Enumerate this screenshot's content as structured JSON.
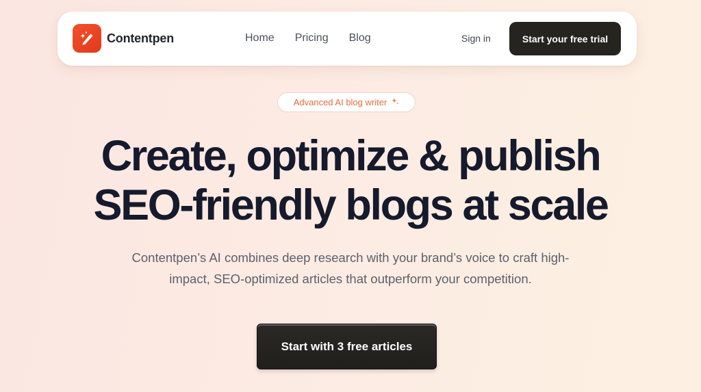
{
  "brand": {
    "name": "Contentpen",
    "accent_color": "#e8452a",
    "logo_icon": "pen-sparkle-icon"
  },
  "nav": {
    "links": [
      {
        "label": "Home"
      },
      {
        "label": "Pricing"
      },
      {
        "label": "Blog"
      }
    ],
    "signin_label": "Sign in",
    "trial_label": "Start your free trial"
  },
  "hero": {
    "badge_label": "Advanced AI blog writer",
    "badge_icon": "sparkle-icon",
    "headline_line1": "Create, optimize & publish",
    "headline_line2": "SEO-friendly blogs at scale",
    "subtext_line1": "Contentpen’s AI combines deep research with your brand’s voice to craft high-",
    "subtext_line2": "impact, SEO-optimized articles that outperform your competition.",
    "cta_label": "Start with 3 free articles"
  },
  "colors": {
    "dark_button": "#26241f",
    "headline": "#151a2c",
    "badge_text": "#e96a3d"
  }
}
